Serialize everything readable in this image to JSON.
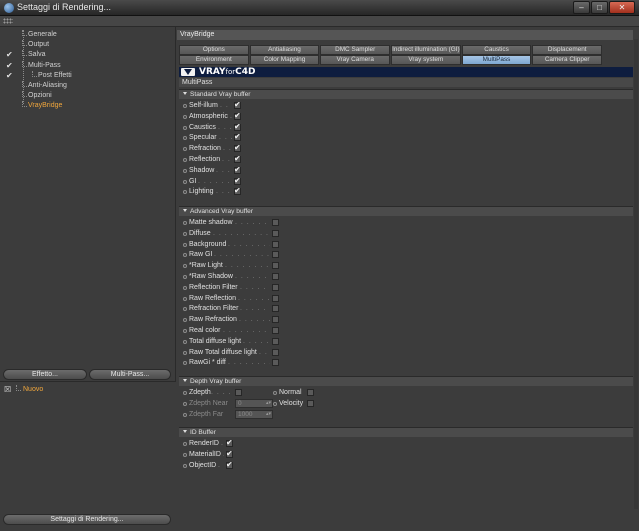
{
  "window": {
    "title": "Settaggi di Rendering...",
    "controls": [
      "–",
      "□",
      "✕"
    ]
  },
  "left": {
    "tree": [
      {
        "label": "Generale",
        "checked": false,
        "level": 0,
        "active": false
      },
      {
        "label": "Output",
        "checked": false,
        "level": 0,
        "active": false
      },
      {
        "label": "Salva",
        "checked": true,
        "level": 0,
        "active": false
      },
      {
        "label": "Multi-Pass",
        "checked": true,
        "level": 0,
        "active": false
      },
      {
        "label": "Post Effetti",
        "checked": true,
        "level": 1,
        "active": false
      },
      {
        "label": "Anti-Aliasing",
        "checked": false,
        "level": 0,
        "active": false
      },
      {
        "label": "Opzioni",
        "checked": false,
        "level": 0,
        "active": false
      },
      {
        "label": "VrayBridge",
        "checked": false,
        "level": 0,
        "active": true
      }
    ],
    "effetto_button": "Effetto...",
    "multipass_button": "Multi-Pass...",
    "lower_item": "Nuovo",
    "footer_button": "Settaggi di Rendering..."
  },
  "right": {
    "header": "VrayBridge",
    "tabs_row1": [
      "Options",
      "Antialiasing",
      "DMC Sampler",
      "Indirect illumination (GI)",
      "Caustics",
      "Displacement"
    ],
    "tabs_row2": [
      "Environment",
      "Color Mapping",
      "Vray Camera",
      "Vray system",
      "MultiPass",
      "Camera Clipper"
    ],
    "active_tab": "MultiPass",
    "logo": {
      "prefix": "VRAY",
      "for": "for",
      "suffix": "C4D"
    },
    "panel_label": "MultiPass",
    "standard": {
      "title": "Standard Vray buffer",
      "items": [
        {
          "label": "Self-illum",
          "checked": true
        },
        {
          "label": "Atmospheric",
          "checked": true
        },
        {
          "label": "Caustics",
          "checked": true
        },
        {
          "label": "Specular",
          "checked": true
        },
        {
          "label": "Refraction",
          "checked": true
        },
        {
          "label": "Reflection",
          "checked": true
        },
        {
          "label": "Shadow",
          "checked": true
        },
        {
          "label": "GI",
          "checked": true
        },
        {
          "label": "Lighting",
          "checked": true
        }
      ]
    },
    "advanced": {
      "title": "Advanced Vray buffer",
      "items": [
        {
          "label": "Matte shadow",
          "checked": false
        },
        {
          "label": "Diffuse",
          "checked": false
        },
        {
          "label": "Background",
          "checked": false
        },
        {
          "label": "Raw GI",
          "checked": false
        },
        {
          "label": "*Raw Light",
          "checked": false
        },
        {
          "label": "*Raw Shadow",
          "checked": false
        },
        {
          "label": "Reflection Filter",
          "checked": false
        },
        {
          "label": "Raw Reflection",
          "checked": false
        },
        {
          "label": "Refraction Filter",
          "checked": false
        },
        {
          "label": "Raw Refraction",
          "checked": false
        },
        {
          "label": "Real color",
          "checked": false
        },
        {
          "label": "Total diffuse light",
          "checked": false
        },
        {
          "label": "Raw Total diffuse light",
          "checked": false
        },
        {
          "label": "RawGi * diff",
          "checked": false
        }
      ]
    },
    "depth": {
      "title": "Depth Vray buffer",
      "zdepth": "Zdepth",
      "normal": "Normal",
      "velocity": "Velocity",
      "near_label": "Zdepth Near",
      "near_value": "0",
      "far_label": "Zdepth Far",
      "far_value": "1000"
    },
    "id": {
      "title": "ID Buffer",
      "items": [
        {
          "label": "RenderID",
          "checked": true
        },
        {
          "label": "MaterialID",
          "checked": true
        },
        {
          "label": "ObjectID",
          "checked": true
        }
      ]
    }
  }
}
